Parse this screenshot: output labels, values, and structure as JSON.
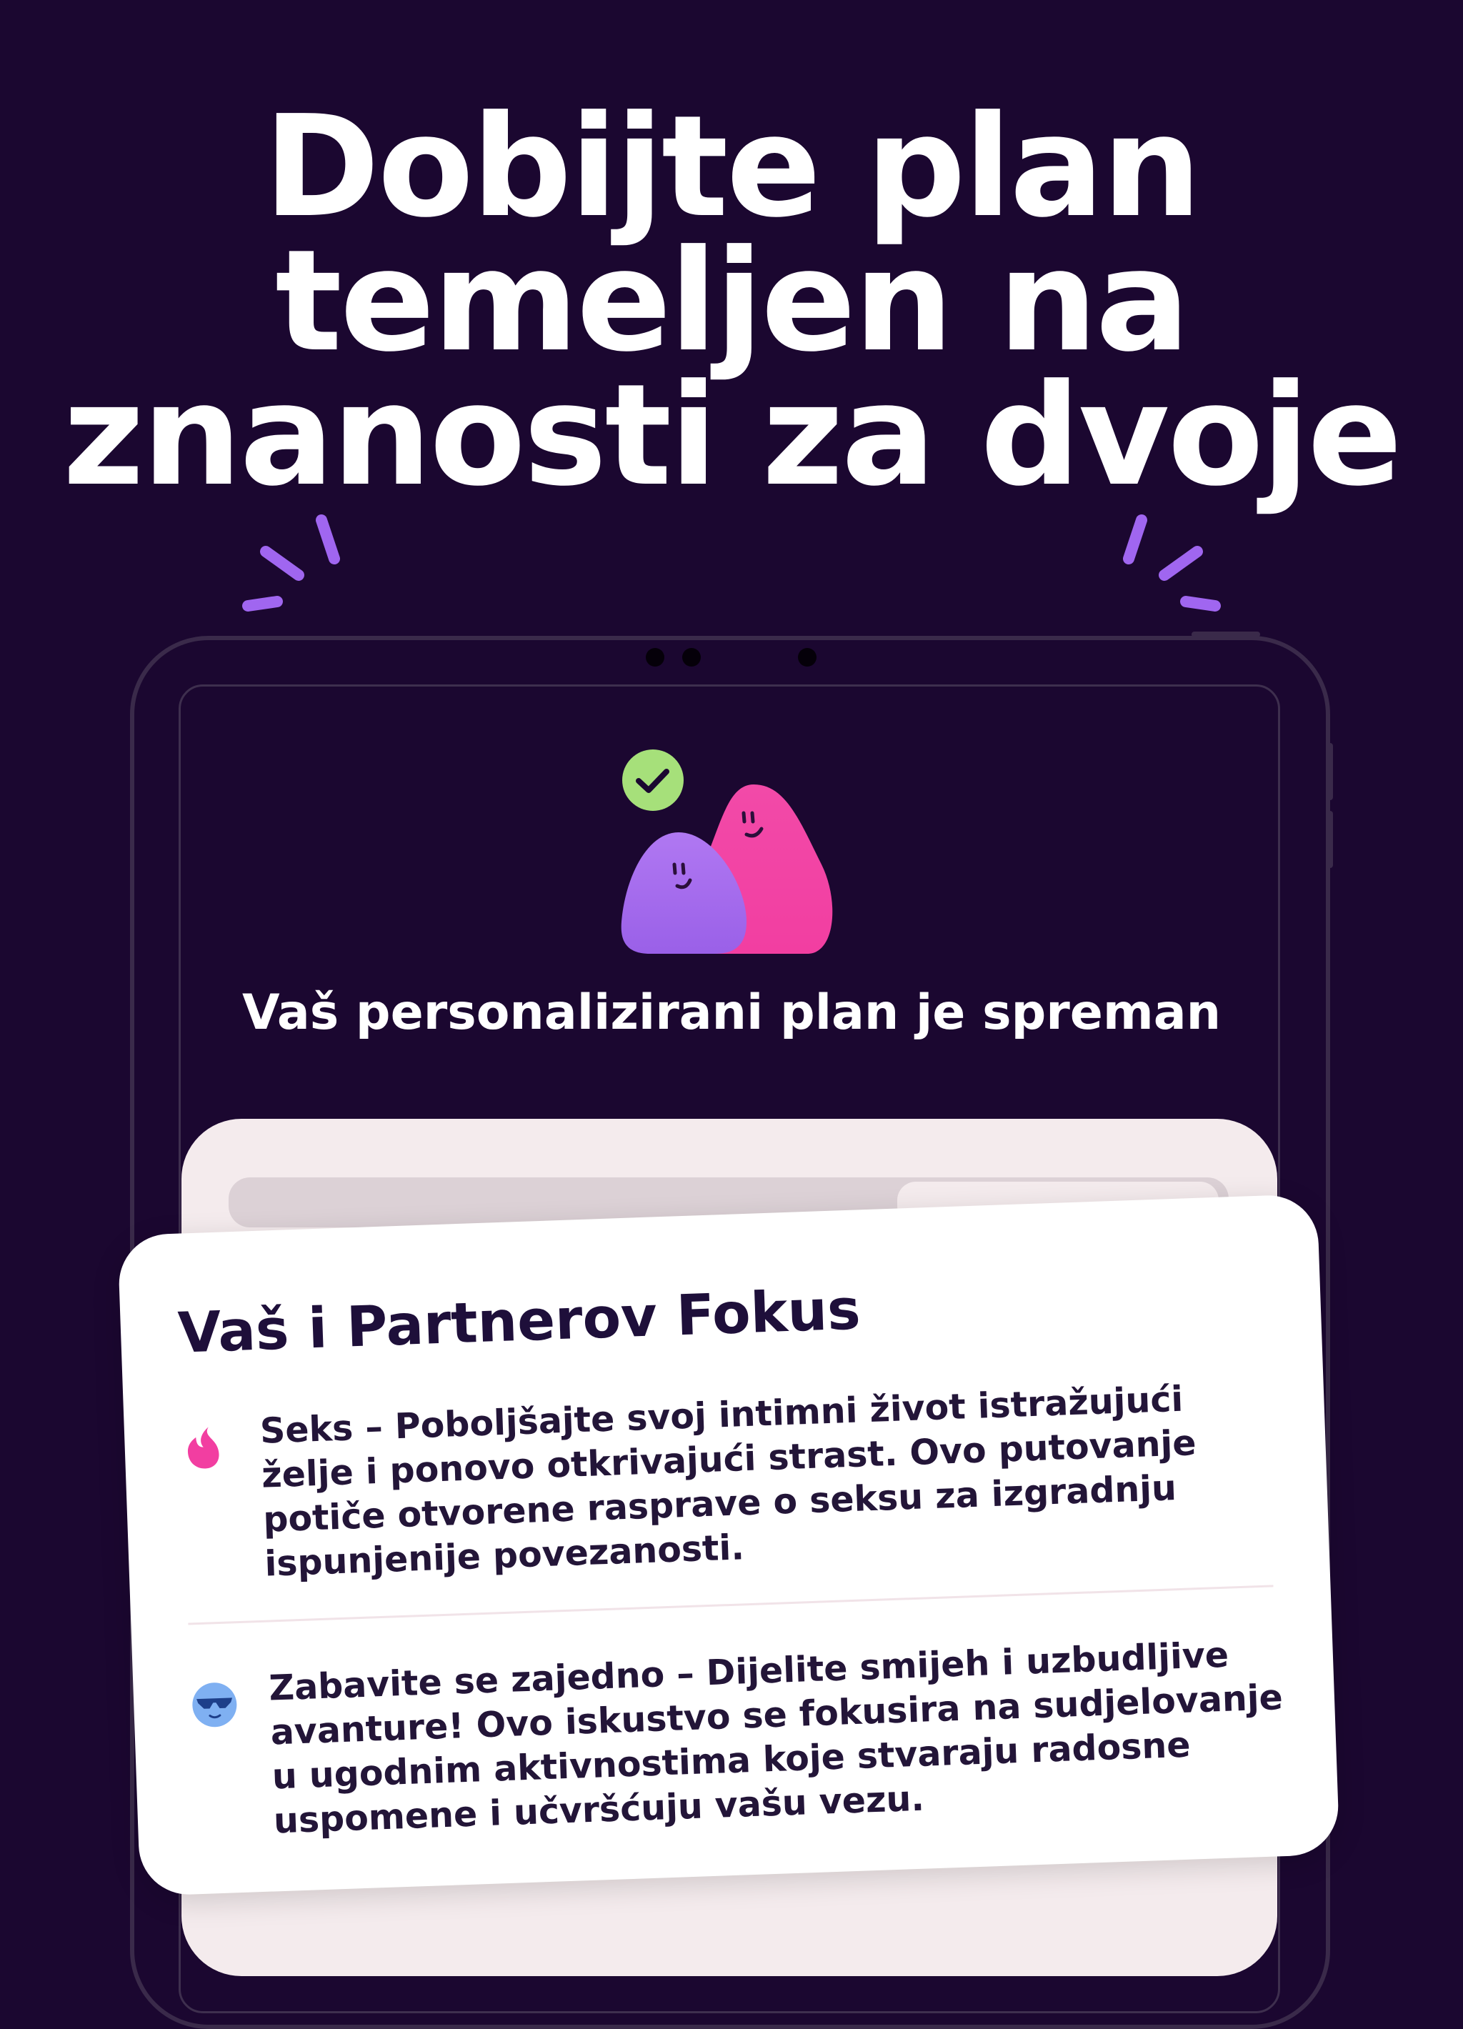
{
  "headline": {
    "line1": "Dobijte plan",
    "line2": "temeljen na",
    "line3": "znanosti za dvoje"
  },
  "colors": {
    "background": "#1b0730",
    "accent_purple": "#a066f0",
    "accent_pink": "#f23ea1",
    "check_green": "#a6e07a",
    "card": "#ffffff",
    "text_dark": "#231538"
  },
  "device": {
    "plan_ready_text": "Vaš personalizirani plan je spreman",
    "illustration": "two-blob-characters-with-check-icon"
  },
  "focus_card": {
    "title": "Vaš i Partnerov Fokus",
    "items": [
      {
        "icon": "flame-icon",
        "text": "Seks – Poboljšajte svoj intimni život istražujući želje i ponovo otkrivajući strast. Ovo putovanje potiče otvorene rasprave o seksu za izgradnju ispunjenije povezanosti."
      },
      {
        "icon": "sunglasses-face-icon",
        "text": "Zabavite se zajedno – Dijelite smijeh i uzbudljive avanture! Ovo iskustvo se fokusira na sudjelovanje u ugodnim aktivnostima koje stvaraju radosne uspomene i učvršćuju vašu vezu."
      }
    ]
  }
}
